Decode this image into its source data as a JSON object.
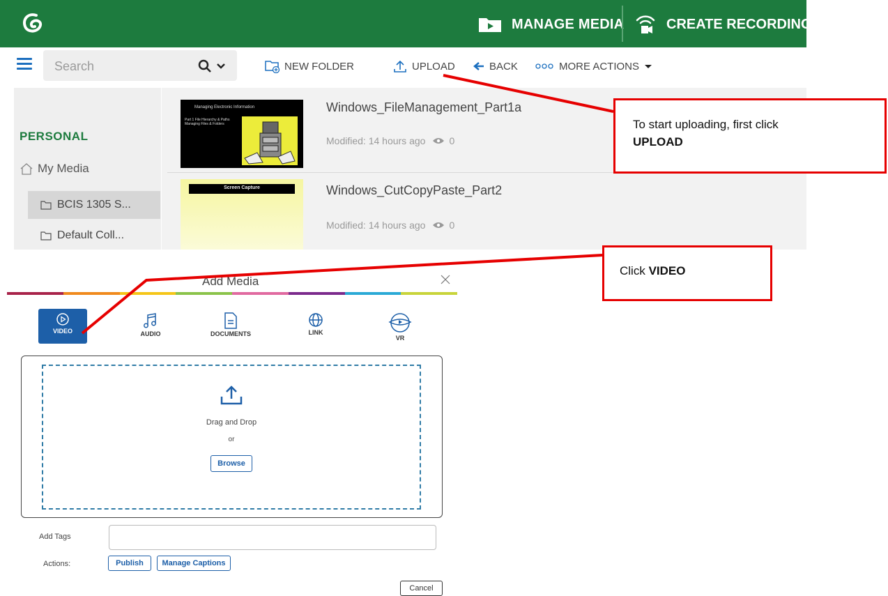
{
  "header": {
    "manage_media": "MANAGE MEDIA",
    "create_recording": "CREATE RECORDING",
    "brand_color": "#1d7b3e"
  },
  "toolbar": {
    "search_placeholder": "Search",
    "new_folder": "NEW FOLDER",
    "upload": "UPLOAD",
    "back": "BACK",
    "more_actions": "MORE ACTIONS"
  },
  "sidebar": {
    "section": "PERSONAL",
    "my_media": "My Media",
    "collections": [
      {
        "label": "BCIS 1305 S..."
      },
      {
        "label": "Default Coll..."
      }
    ]
  },
  "media": [
    {
      "title": "Windows_FileManagement_Part1a",
      "modified": "Modified: 14 hours ago",
      "views": "0",
      "thumb_title": "Managing Electronic Information",
      "thumb_sub": "Part 1 File Hierarchy & Paths Managing Files & Folders"
    },
    {
      "title": "Windows_CutCopyPaste_Part2",
      "modified": "Modified: 14 hours ago",
      "views": "0",
      "thumb_title": "Screen Capture"
    }
  ],
  "callouts": {
    "upload_text": "To start uploading, first click",
    "upload_bold": "UPLOAD",
    "video_text": "Click",
    "video_bold": "VIDEO",
    "color": "#e60000"
  },
  "dialog": {
    "title": "Add Media",
    "types": [
      {
        "label": "VIDEO",
        "icon": "play-circle-icon",
        "selected": true
      },
      {
        "label": "AUDIO",
        "icon": "music-note-icon"
      },
      {
        "label": "DOCUMENTS",
        "icon": "document-icon"
      },
      {
        "label": "LINK",
        "icon": "globe-icon"
      },
      {
        "label": "VR",
        "icon": "vr-headset-icon"
      }
    ],
    "drag_drop": "Drag and Drop",
    "or": "or",
    "browse": "Browse",
    "tags_label": "Add Tags",
    "actions_label": "Actions:",
    "publish": "Publish",
    "manage_captions": "Manage Captions",
    "cancel": "Cancel",
    "accent_color": "#1d5fa8",
    "color_bar": [
      "#a8234a",
      "#f08a1d",
      "#f5c518",
      "#8bc34a",
      "#e06aa0",
      "#7b2a8c",
      "#2aa9d6",
      "#c8d43a"
    ]
  }
}
